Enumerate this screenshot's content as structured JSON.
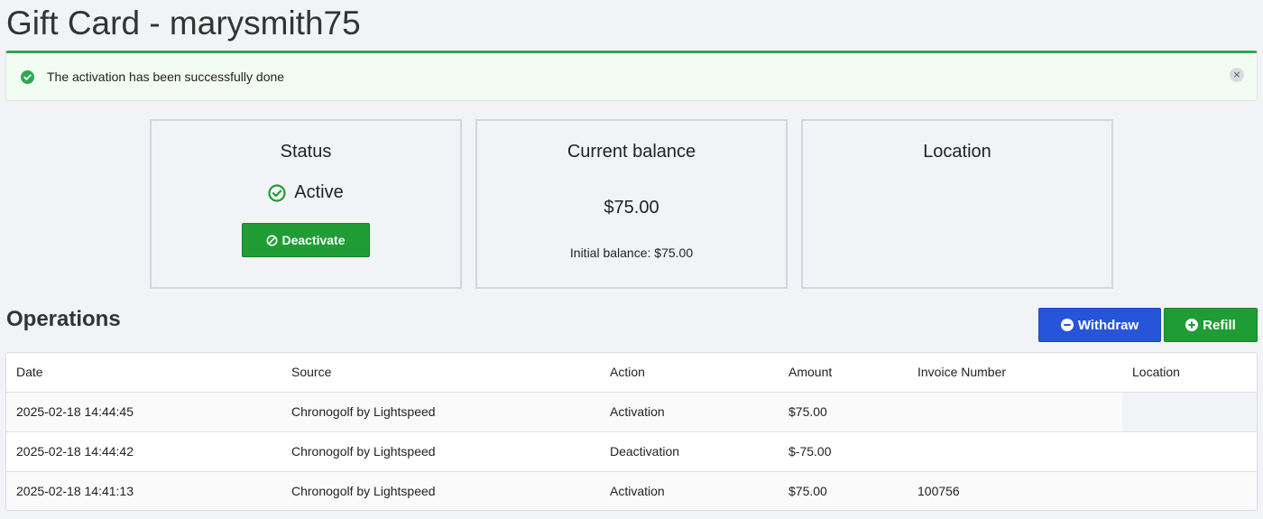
{
  "page": {
    "title": "Gift Card - marysmith75"
  },
  "alert": {
    "message": "The activation has been successfully done",
    "close_glyph": "×",
    "icon": "check-circle-icon",
    "color": "#2fa84f"
  },
  "status_card": {
    "title": "Status",
    "status": "Active",
    "button_label": "Deactivate"
  },
  "balance_card": {
    "title": "Current balance",
    "balance": "$75.00",
    "initial_balance": "Initial balance: $75.00"
  },
  "location_card": {
    "title": "Location"
  },
  "operations": {
    "title": "Operations",
    "withdraw_label": "Withdraw",
    "refill_label": "Refill",
    "columns": [
      "Date",
      "Source",
      "Action",
      "Amount",
      "Invoice Number",
      "Location"
    ],
    "rows": [
      [
        "2025-02-18 14:44:45",
        "Chronogolf by Lightspeed",
        "Activation",
        "$75.00",
        "",
        ""
      ],
      [
        "2025-02-18 14:44:42",
        "Chronogolf by Lightspeed",
        "Deactivation",
        "$-75.00",
        "",
        ""
      ],
      [
        "2025-02-18 14:41:13",
        "Chronogolf by Lightspeed",
        "Activation",
        "$75.00",
        "100756",
        ""
      ]
    ]
  },
  "colors": {
    "green": "#1f9d34",
    "blue": "#2655d9",
    "background": "#f1f3f7"
  }
}
